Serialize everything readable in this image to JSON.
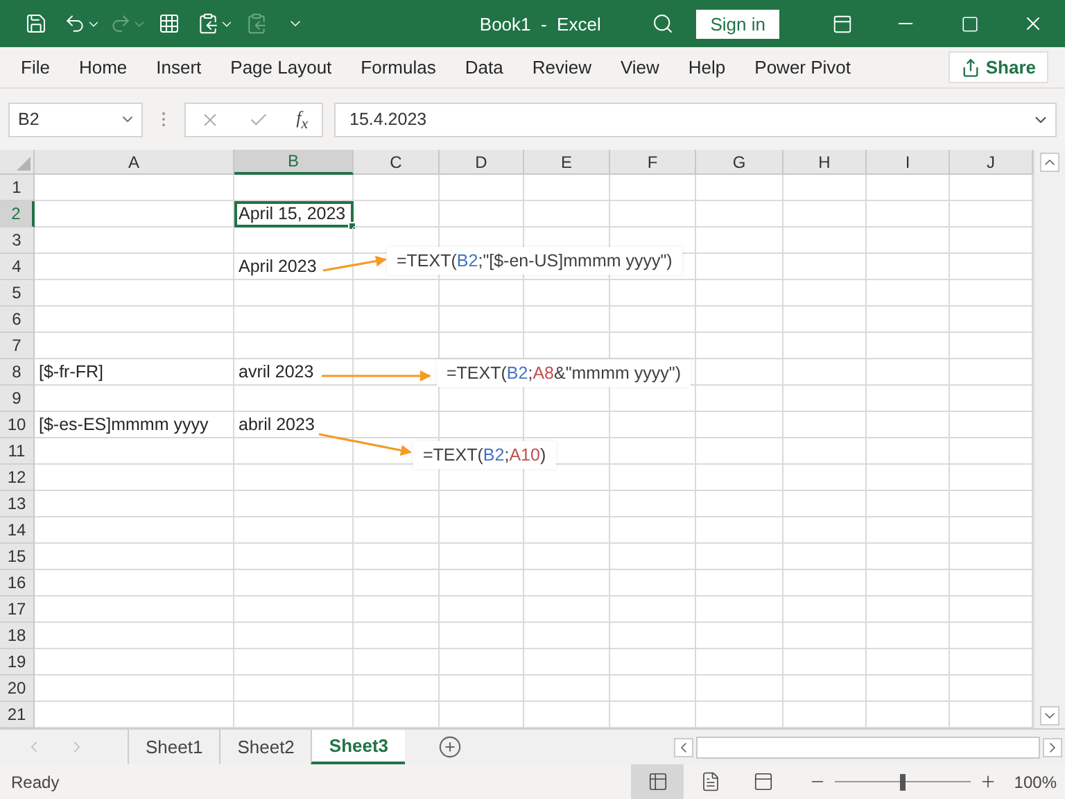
{
  "title_bar": {
    "title": "Book1  -  Excel",
    "sign_in": "Sign in"
  },
  "ribbon_tabs": [
    "File",
    "Home",
    "Insert",
    "Page Layout",
    "Formulas",
    "Data",
    "Review",
    "View",
    "Help",
    "Power Pivot"
  ],
  "share": "Share",
  "formula_bar": {
    "name_box": "B2",
    "function_label": "f$_{x}$",
    "formula": "15.4.2023"
  },
  "columns": [
    {
      "label": "A",
      "selected": false
    },
    {
      "label": "B",
      "selected": true
    },
    {
      "label": "C",
      "selected": false
    },
    {
      "label": "D",
      "selected": false
    },
    {
      "label": "E",
      "selected": false
    },
    {
      "label": "F",
      "selected": false
    },
    {
      "label": "G",
      "selected": false
    },
    {
      "label": "H",
      "selected": false
    },
    {
      "label": "I",
      "selected": false
    },
    {
      "label": "J",
      "selected": false
    }
  ],
  "rows": [
    {
      "number": "1",
      "selected": false
    },
    {
      "number": "2",
      "selected": true,
      "b": {
        "text": "April 15, 2023",
        "active": true
      }
    },
    {
      "number": "3",
      "selected": false
    },
    {
      "number": "4",
      "selected": false,
      "b": {
        "text": "April 2023",
        "active": false
      }
    },
    {
      "number": "5",
      "selected": false
    },
    {
      "number": "6",
      "selected": false
    },
    {
      "number": "7",
      "selected": false
    },
    {
      "number": "8",
      "selected": false,
      "a": {
        "text": "[$-fr-FR]",
        "active": false
      },
      "b": {
        "text": "avril 2023",
        "active": false
      }
    },
    {
      "number": "9",
      "selected": false
    },
    {
      "number": "10",
      "selected": false,
      "a": {
        "text": "[$-es-ES]mmmm yyyy",
        "active": false
      },
      "b": {
        "text": "abril 2023",
        "active": false
      }
    },
    {
      "number": "11",
      "selected": false
    },
    {
      "number": "12",
      "selected": false
    },
    {
      "number": "13",
      "selected": false
    },
    {
      "number": "14",
      "selected": false
    },
    {
      "number": "15",
      "selected": false
    },
    {
      "number": "16",
      "selected": false
    },
    {
      "number": "17",
      "selected": false
    },
    {
      "number": "18",
      "selected": false
    },
    {
      "number": "19",
      "selected": false
    },
    {
      "number": "20",
      "selected": false
    },
    {
      "number": "21",
      "selected": false
    }
  ],
  "callouts": [
    {
      "parts": [
        {
          "text": "=TEXT(",
          "color": "#404040"
        },
        {
          "text": "B2",
          "color": "#4472c4"
        },
        {
          "text": ";\"[$-en-US]mmmm yyyy\")",
          "color": "#404040"
        }
      ]
    },
    {
      "parts": [
        {
          "text": "=TEXT(",
          "color": "#404040"
        },
        {
          "text": "B2",
          "color": "#4472c4"
        },
        {
          "text": ";",
          "color": "#404040"
        },
        {
          "text": "A8",
          "color": "#c0504d"
        },
        {
          "text": "&\"mmmm yyyy\")",
          "color": "#404040"
        }
      ]
    },
    {
      "parts": [
        {
          "text": "=TEXT(",
          "color": "#404040"
        },
        {
          "text": "B2",
          "color": "#4472c4"
        },
        {
          "text": ";",
          "color": "#404040"
        },
        {
          "text": "A10",
          "color": "#c0504d"
        },
        {
          "text": ")",
          "color": "#404040"
        }
      ]
    }
  ],
  "sheet_tabs": [
    {
      "label": "Sheet1",
      "selected": false
    },
    {
      "label": "Sheet2",
      "selected": false
    },
    {
      "label": "Sheet3",
      "selected": true
    }
  ],
  "status_bar": {
    "status": "Ready",
    "views": [
      {
        "kind": "normal",
        "selected": true
      },
      {
        "kind": "layout",
        "selected": false
      },
      {
        "kind": "pagebreak",
        "selected": false
      }
    ],
    "zoom": {
      "level": 0.5,
      "reading": "100%"
    }
  }
}
